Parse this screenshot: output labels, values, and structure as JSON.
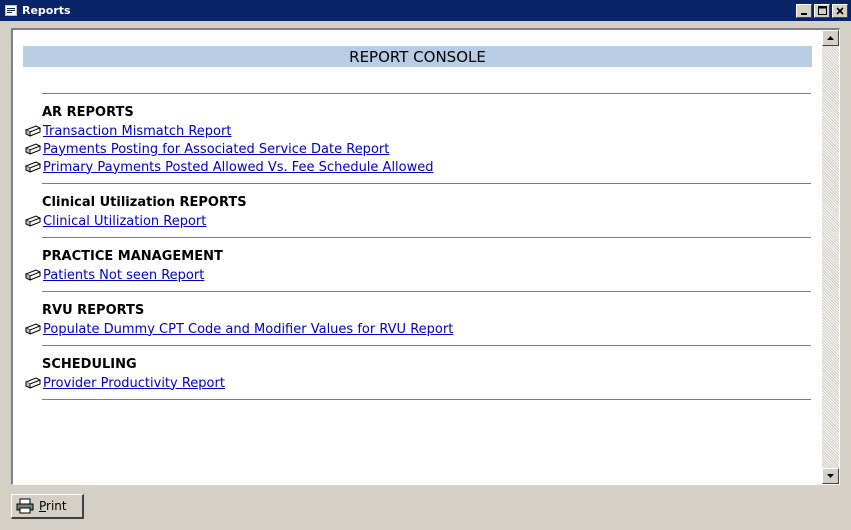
{
  "window": {
    "title": "Reports",
    "icon": "reports-window-icon",
    "controls": [
      "minimize-icon",
      "maximize-icon",
      "close-icon"
    ]
  },
  "console": {
    "header": "REPORT CONSOLE",
    "sections": [
      {
        "title": "AR REPORTS",
        "reports": [
          "Transaction Mismatch Report",
          "Payments Posting for Associated Service Date Report",
          "Primary Payments Posted Allowed Vs. Fee Schedule Allowed"
        ]
      },
      {
        "title": "Clinical Utilization REPORTS",
        "reports": [
          "Clinical Utilization Report"
        ]
      },
      {
        "title": "PRACTICE MANAGEMENT",
        "reports": [
          "Patients Not seen Report"
        ]
      },
      {
        "title": "RVU REPORTS",
        "reports": [
          "Populate Dummy CPT Code and Modifier Values for RVU Report"
        ]
      },
      {
        "title": "SCHEDULING",
        "reports": [
          "Provider Productivity Report"
        ]
      }
    ]
  },
  "report_icon": "report-link-icon",
  "print_button": {
    "label_first": "P",
    "label_rest": "rint",
    "icon": "printer-icon"
  },
  "colors": {
    "titlebar": "#0a246a",
    "header_band": "#b8cce4",
    "link": "#0000cc",
    "chrome": "#d4d0c8"
  }
}
